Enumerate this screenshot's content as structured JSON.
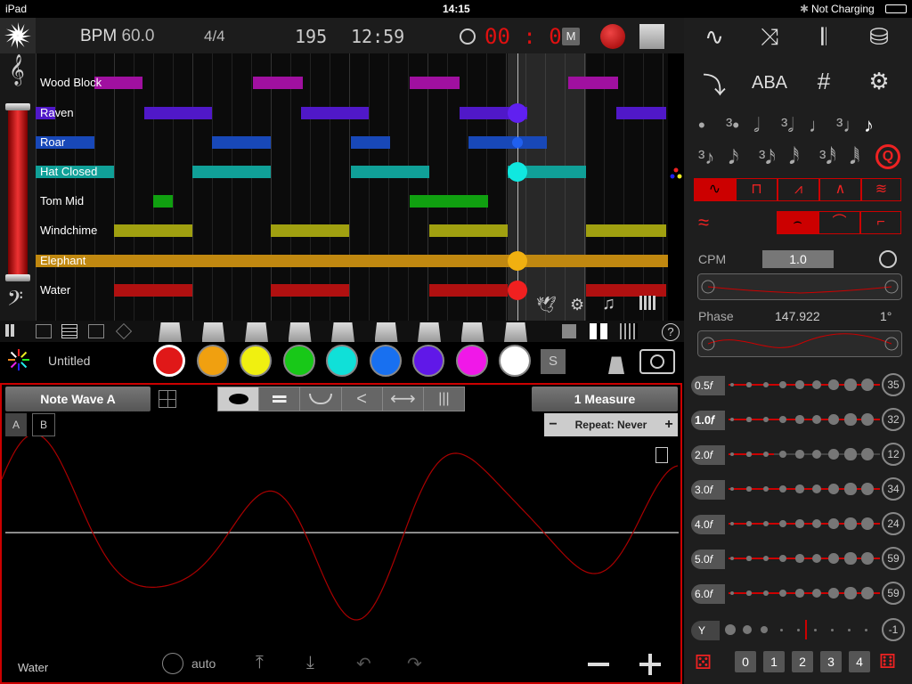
{
  "status": {
    "device": "iPad",
    "time": "14:15",
    "battery": "Not Charging"
  },
  "header": {
    "bpm_label": "BPM",
    "bpm_value": "60.0",
    "time_sig": "4/4",
    "counter": "195",
    "clock": "12:59",
    "rec_time": "00 : 00",
    "metronome_label": "M"
  },
  "tracks": [
    {
      "name": "Wood Block",
      "color": "#a010a0"
    },
    {
      "name": "Raven",
      "color": "#5018c8"
    },
    {
      "name": "Roar",
      "color": "#1848b8"
    },
    {
      "name": "Hat Closed",
      "color": "#10a098"
    },
    {
      "name": "Tom Mid",
      "color": "#10a010"
    },
    {
      "name": "Windchime",
      "color": "#a0a010"
    },
    {
      "name": "Elephant",
      "color": "#c08810"
    },
    {
      "name": "Water",
      "color": "#b01010"
    }
  ],
  "project": {
    "name": "Untitled",
    "solo_label": "S"
  },
  "palette": [
    "#e01818",
    "#f0a010",
    "#f0f010",
    "#18c818",
    "#10e0d8",
    "#1870f0",
    "#6018e8",
    "#f018e8",
    "#ffffff"
  ],
  "wave": {
    "title": "Note Wave A",
    "tab_a": "A",
    "tab_b": "B",
    "length": "1 Measure",
    "repeat": "Repeat: Never",
    "track_name": "Water",
    "mode": "auto",
    "minus": "−",
    "plus": "+"
  },
  "right": {
    "aba_label": "ABA",
    "cpm_label": "CPM",
    "cpm_value": "1.0",
    "phase_label": "Phase",
    "phase_value": "147.922",
    "phase_deg": "1°",
    "harmonics": [
      {
        "label": "0.5𝑓",
        "value": "35",
        "bold": false,
        "fill": 1.0
      },
      {
        "label": "1.0𝑓",
        "value": "32",
        "bold": true,
        "fill": 1.0
      },
      {
        "label": "2.0𝑓",
        "value": "12",
        "bold": false,
        "fill": 0.3
      },
      {
        "label": "3.0𝑓",
        "value": "34",
        "bold": false,
        "fill": 1.0
      },
      {
        "label": "4.0𝑓",
        "value": "24",
        "bold": false,
        "fill": 1.0
      },
      {
        "label": "5.0𝑓",
        "value": "59",
        "bold": false,
        "fill": 1.0
      },
      {
        "label": "6.0𝑓",
        "value": "59",
        "bold": false,
        "fill": 1.0
      }
    ],
    "y_label": "Y",
    "y_value": "-1",
    "bottom_nums": [
      "0",
      "1",
      "2",
      "3",
      "4"
    ]
  }
}
